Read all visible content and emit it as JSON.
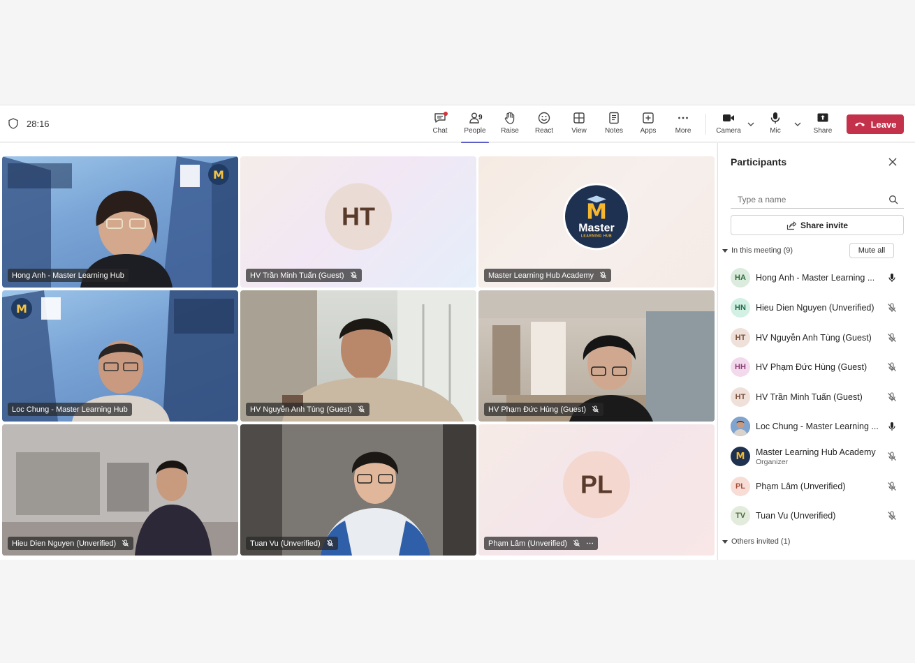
{
  "toolbar": {
    "timer": "28:16",
    "people_count": "9",
    "tools": {
      "chat": "Chat",
      "people": "People",
      "raise": "Raise",
      "react": "React",
      "view": "View",
      "notes": "Notes",
      "apps": "Apps",
      "more": "More",
      "camera": "Camera",
      "mic": "Mic",
      "share": "Share"
    },
    "leave_label": "Leave"
  },
  "tiles": [
    {
      "name": "Hong Anh - Master Learning Hub",
      "muted": false,
      "kind": "video"
    },
    {
      "name": "HV Trần Minh Tuấn (Guest)",
      "muted": true,
      "kind": "initials",
      "initials": "HT"
    },
    {
      "name": "Master Learning Hub Academy",
      "muted": true,
      "kind": "logo"
    },
    {
      "name": "Loc Chung - Master Learning Hub",
      "muted": false,
      "kind": "video"
    },
    {
      "name": "HV Nguyễn Anh Tùng (Guest)",
      "muted": true,
      "kind": "video"
    },
    {
      "name": "HV Phạm Đức Hùng (Guest)",
      "muted": true,
      "kind": "video"
    },
    {
      "name": "Hieu Dien Nguyen (Unverified)",
      "muted": true,
      "kind": "video"
    },
    {
      "name": "Tuan Vu (Unverified)",
      "muted": true,
      "kind": "video"
    },
    {
      "name": "Phạm Lâm (Unverified)",
      "muted": true,
      "kind": "initials",
      "initials": "PL"
    }
  ],
  "logo": {
    "big": "Master",
    "small": "LEARNING HUB",
    "letter": "M"
  },
  "panel": {
    "title": "Participants",
    "search_placeholder": "Type a name",
    "share_invite": "Share invite",
    "in_meeting": "In this meeting (9)",
    "mute_all": "Mute all",
    "others_invited": "Others invited (1)",
    "participants": [
      {
        "initials": "HA",
        "name": "Hong Anh - Master Learning ...",
        "role": "",
        "mic": "on"
      },
      {
        "initials": "HN",
        "name": "Hieu Dien Nguyen (Unverified)",
        "role": "",
        "mic": "off"
      },
      {
        "initials": "HT",
        "name": "HV Nguyễn Anh Tùng (Guest)",
        "role": "",
        "mic": "off"
      },
      {
        "initials": "HH",
        "name": "HV Phạm Đức Hùng (Guest)",
        "role": "",
        "mic": "off"
      },
      {
        "initials": "HT",
        "name": "HV Trần Minh Tuấn (Guest)",
        "role": "",
        "mic": "off"
      },
      {
        "initials": "",
        "name": "Loc Chung - Master Learning ...",
        "role": "",
        "mic": "on"
      },
      {
        "initials": "",
        "name": "Master Learning Hub Academy",
        "role": "Organizer",
        "mic": "off"
      },
      {
        "initials": "PL",
        "name": "Phạm Lâm (Unverified)",
        "role": "",
        "mic": "off"
      },
      {
        "initials": "TV",
        "name": "Tuan Vu (Unverified)",
        "role": "",
        "mic": "off"
      }
    ]
  },
  "colors": {
    "leave": "#c4314b",
    "accent": "#5b5fc7",
    "muted_icon": "#616161"
  }
}
